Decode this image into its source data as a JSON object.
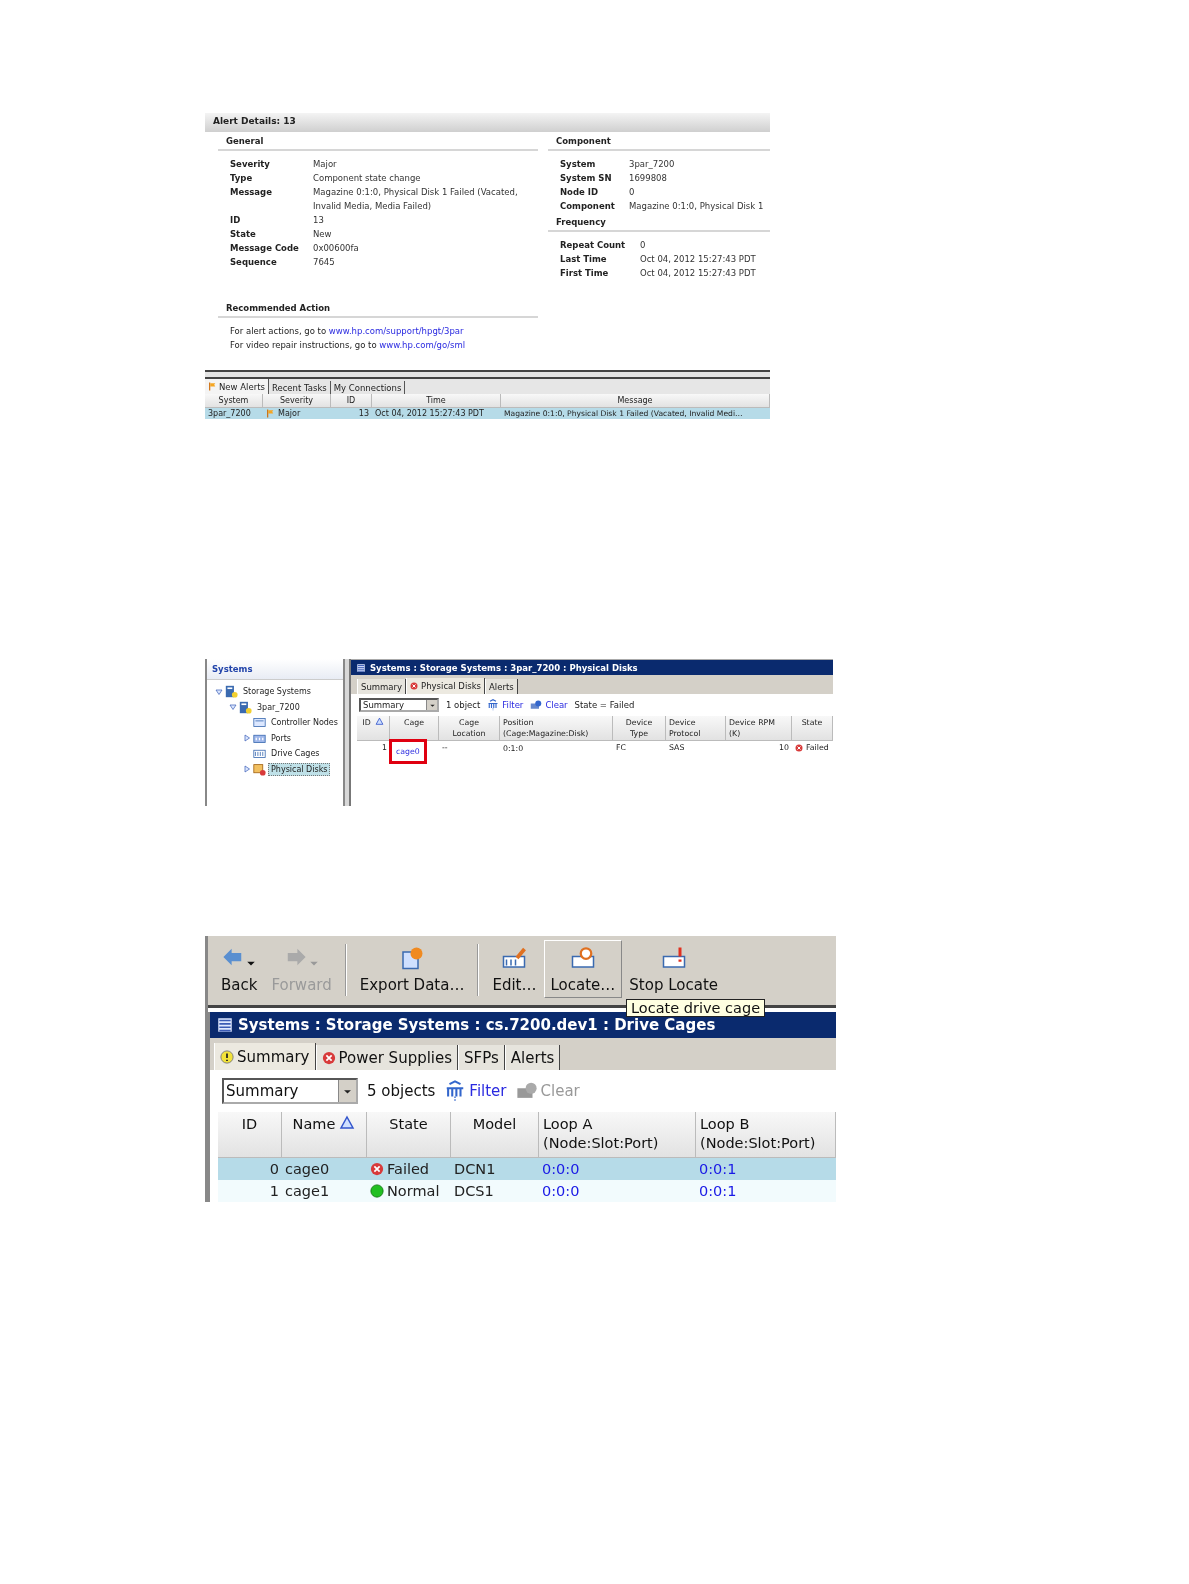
{
  "alert_details": {
    "title": "Alert Details: 13",
    "general": {
      "heading": "General",
      "fields": [
        {
          "label": "Severity",
          "value": "Major"
        },
        {
          "label": "Type",
          "value": "Component state change"
        },
        {
          "label": "Message",
          "value": "Magazine 0:1:0, Physical Disk 1 Failed (Vacated, Invalid Media, Media Failed)"
        },
        {
          "label": "ID",
          "value": "13"
        },
        {
          "label": "State",
          "value": "New"
        },
        {
          "label": "Message Code",
          "value": "0x00600fa"
        },
        {
          "label": "Sequence",
          "value": "7645"
        }
      ]
    },
    "component": {
      "heading": "Component",
      "fields": [
        {
          "label": "System",
          "value": "3par_7200"
        },
        {
          "label": "System SN",
          "value": "1699808"
        },
        {
          "label": "Node ID",
          "value": "0"
        },
        {
          "label": "Component",
          "value": "Magazine 0:1:0, Physical Disk 1"
        }
      ]
    },
    "frequency": {
      "heading": "Frequency",
      "fields": [
        {
          "label": "Repeat Count",
          "value": "0"
        },
        {
          "label": "Last Time",
          "value": "Oct 04, 2012 15:27:43 PDT"
        },
        {
          "label": "First Time",
          "value": "Oct 04, 2012 15:27:43 PDT"
        }
      ]
    },
    "recommended_action": {
      "heading": "Recommended Action",
      "lines": [
        {
          "text": "For alert actions, go to",
          "link": "www.hp.com/support/hpgt/3par"
        },
        {
          "text": "For video repair instructions, go to",
          "link": "www.hp.com/go/sml"
        }
      ]
    },
    "bottom_tabs": [
      {
        "label": "New Alerts",
        "selected": true,
        "flag": true
      },
      {
        "label": "Recent Tasks",
        "selected": false,
        "flag": false
      },
      {
        "label": "My Connections",
        "selected": false,
        "flag": false
      }
    ],
    "alerts_table": {
      "columns": [
        "System",
        "Severity",
        "ID",
        "Time",
        "Message"
      ],
      "rows": [
        {
          "selected": true,
          "system": "3par_7200",
          "severity": "Major",
          "id": "13",
          "time": "Oct 04, 2012 15:27:43 PDT",
          "message": "Magazine 0:1:0, Physical Disk 1 Failed (Vacated, Invalid Medi…"
        }
      ]
    }
  },
  "physical_disks": {
    "sidebar": {
      "title": "Systems",
      "tree": [
        {
          "label": "Storage Systems",
          "expanded": true,
          "selected": false,
          "children": [
            {
              "label": "3par_7200",
              "expanded": true,
              "selected": false,
              "children": [
                {
                  "label": "Controller Nodes",
                  "selected": false
                },
                {
                  "label": "Ports",
                  "expanded": false,
                  "selected": false
                },
                {
                  "label": "Drive Cages",
                  "selected": false
                },
                {
                  "label": "Physical Disks",
                  "expanded": false,
                  "selected": true
                }
              ]
            }
          ]
        }
      ]
    },
    "path": "Systems : Storage Systems : 3par_7200 : Physical Disks",
    "tabs": [
      {
        "label": "Summary",
        "selected": false,
        "error": false
      },
      {
        "label": "Physical Disks",
        "selected": true,
        "error": true
      },
      {
        "label": "Alerts",
        "selected": false,
        "error": false
      }
    ],
    "view_select": "Summary",
    "count": "1 object",
    "filter": "Filter",
    "clear": "Clear",
    "state_filter": "State = Failed",
    "table": {
      "columns": [
        {
          "label": "ID",
          "sorted": true
        },
        {
          "label": "Cage",
          "sorted": false
        },
        {
          "label": "Cage Location",
          "sorted": false
        },
        {
          "label": "Position\n(Cage:Magazine:Disk)",
          "sorted": false
        },
        {
          "label": "Device Type",
          "sorted": false
        },
        {
          "label": "Device\nProtocol",
          "sorted": false
        },
        {
          "label": "Device RPM\n(K)",
          "sorted": false
        },
        {
          "label": "State",
          "sorted": false
        }
      ],
      "rows": [
        {
          "id": "1",
          "cage": "cage0",
          "highlighted": true,
          "cage_location": "--",
          "position": "0:1:0",
          "device_type": "FC",
          "protocol": "SAS",
          "rpm": "10",
          "state": "Failed",
          "failed": true
        }
      ]
    }
  },
  "drive_cages": {
    "toolbar_groups": [
      {
        "buttons": [
          {
            "label": "Back",
            "disabled": false,
            "pressed": false,
            "dropdown": true
          },
          {
            "label": "Forward",
            "disabled": true,
            "pressed": false,
            "dropdown": true
          }
        ]
      },
      {
        "buttons": [
          {
            "label": "Export Data…",
            "disabled": false,
            "pressed": false,
            "dropdown": false
          }
        ]
      },
      {
        "buttons": [
          {
            "label": "Edit…",
            "disabled": false,
            "pressed": false,
            "dropdown": false
          },
          {
            "label": "Locate…",
            "disabled": false,
            "pressed": true,
            "dropdown": false
          },
          {
            "label": "Stop Locate",
            "disabled": false,
            "pressed": false,
            "dropdown": false
          }
        ]
      }
    ],
    "tooltip": "Locate drive cage",
    "path": "Systems : Storage Systems : cs.7200.dev1 : Drive Cages",
    "tabs": [
      {
        "label": "Summary",
        "selected": true,
        "warning": true,
        "error": false
      },
      {
        "label": "Power Supplies",
        "selected": false,
        "warning": false,
        "error": true
      },
      {
        "label": "SFPs",
        "selected": false,
        "warning": false,
        "error": false
      },
      {
        "label": "Alerts",
        "selected": false,
        "warning": false,
        "error": false
      }
    ],
    "view_select": "Summary",
    "count": "5 objects",
    "filter": "Filter",
    "clear": "Clear",
    "clear_disabled": true,
    "table": {
      "columns": [
        {
          "label": "ID",
          "sorted": false
        },
        {
          "label": "Name",
          "sorted": true
        },
        {
          "label": "State",
          "sorted": false
        },
        {
          "label": "Model",
          "sorted": false
        },
        {
          "label": "Loop A\n(Node:Slot:Port)",
          "sorted": false
        },
        {
          "label": "Loop B\n(Node:Slot:Port)",
          "sorted": false
        }
      ],
      "rows": [
        {
          "selected": true,
          "id": "0",
          "name": "cage0",
          "state": "Failed",
          "failed": true,
          "model": "DCN1",
          "loop_a": "0:0:0",
          "loop_b": "0:0:1"
        },
        {
          "selected": false,
          "id": "1",
          "name": "cage1",
          "state": "Normal",
          "failed": false,
          "model": "DCS1",
          "loop_a": "0:0:0",
          "loop_b": "0:0:1"
        }
      ]
    }
  }
}
